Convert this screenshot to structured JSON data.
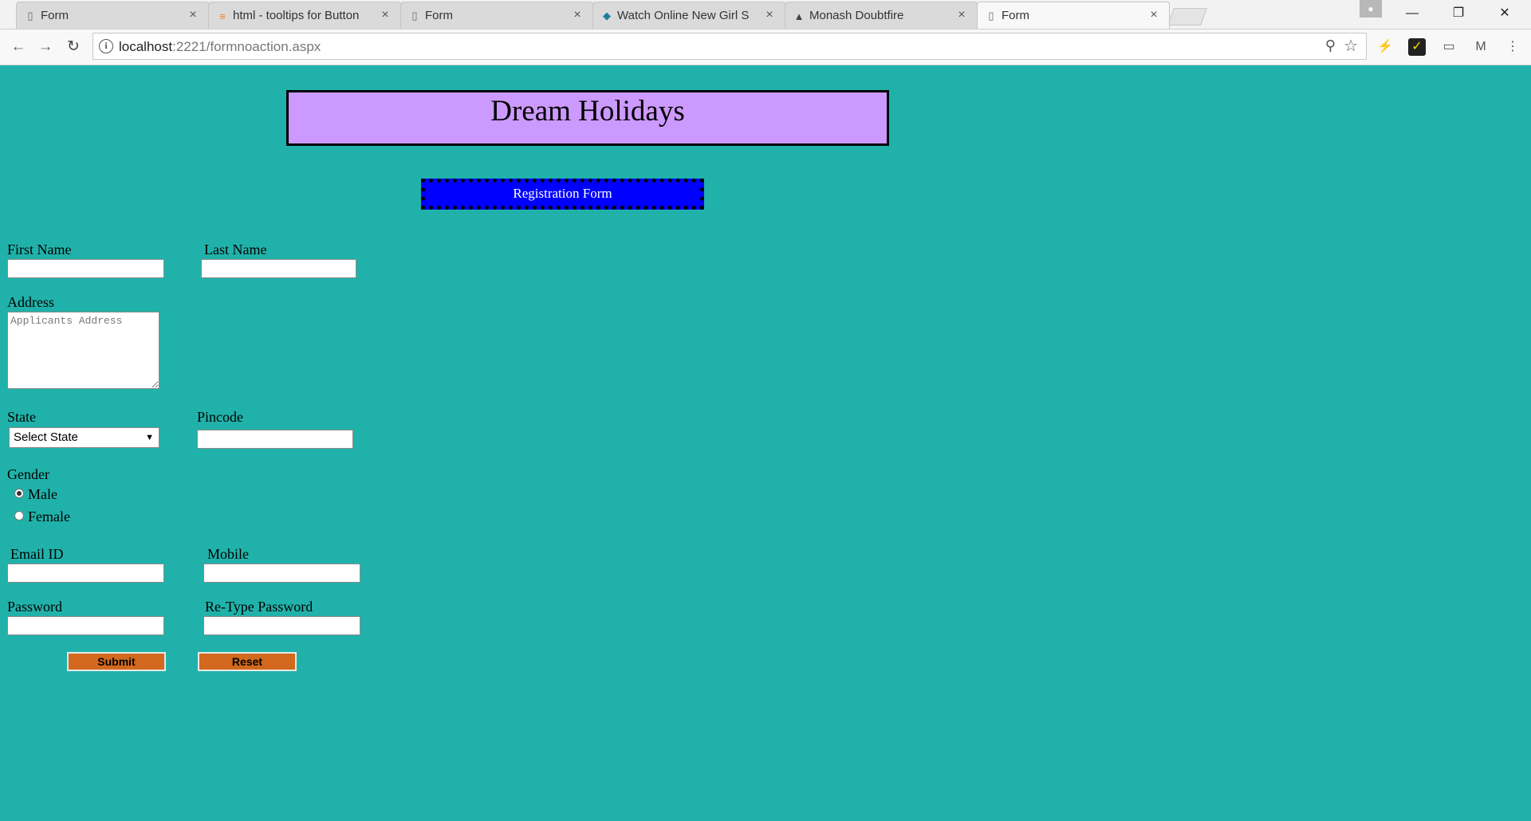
{
  "browser": {
    "tabs": [
      {
        "title": "Form",
        "icon": "page-icon"
      },
      {
        "title": "html - tooltips for Button",
        "icon": "stackoverflow-icon"
      },
      {
        "title": "Form",
        "icon": "page-icon"
      },
      {
        "title": "Watch Online New Girl S",
        "icon": "site-icon"
      },
      {
        "title": "Monash Doubtfire",
        "icon": "site-icon"
      },
      {
        "title": "Form",
        "icon": "page-icon"
      }
    ],
    "close_glyph": "×",
    "url_host": "localhost",
    "url_path": ":2221/formnoaction.aspx",
    "window": {
      "minimize": "—",
      "restore": "❐",
      "close": "✕"
    }
  },
  "page": {
    "header_title": "Dream Holidays",
    "subtitle": "Registration Form",
    "labels": {
      "first_name": "First Name",
      "last_name": "Last Name",
      "address": "Address",
      "state": "State",
      "pincode": "Pincode",
      "gender": "Gender",
      "male": "Male",
      "female": "Female",
      "email": "Email ID",
      "mobile": "Mobile",
      "password": "Password",
      "retype_password": "Re-Type Password"
    },
    "address_placeholder": "Applicants Address",
    "state_selected": "Select State",
    "gender_selected": "Male",
    "buttons": {
      "submit": "Submit",
      "reset": "Reset"
    }
  },
  "colors": {
    "page_bg": "#20b2aa",
    "header_bg": "#cc99ff",
    "reg_bg": "#0000ff",
    "button_bg": "#d2691e"
  }
}
